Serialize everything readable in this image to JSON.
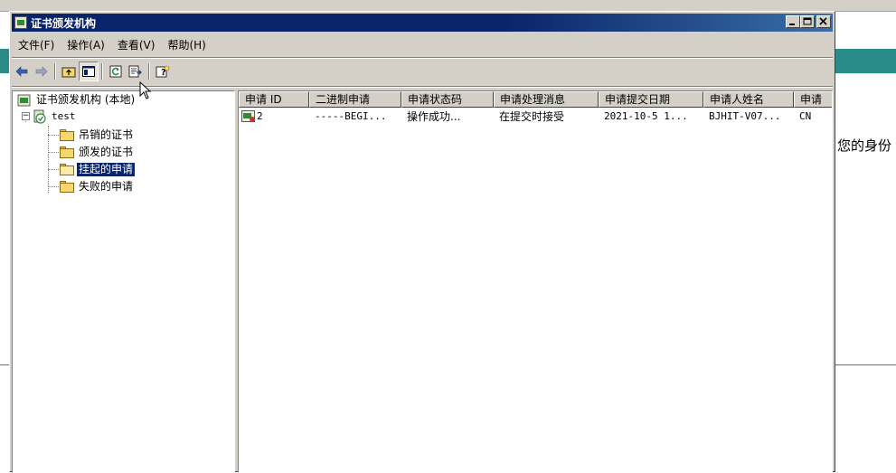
{
  "window": {
    "title": "证书颁发机构",
    "buttons": {
      "minimize": "_",
      "maximize": "□",
      "close": "×"
    }
  },
  "menu": [
    {
      "label": "文件(F)"
    },
    {
      "label": "操作(A)"
    },
    {
      "label": "查看(V)"
    },
    {
      "label": "帮助(H)"
    }
  ],
  "toolbar": {
    "icons": [
      "back-arrow-icon",
      "forward-arrow-icon",
      "up-folder-icon",
      "show-hide-tree-icon",
      "refresh-icon",
      "export-list-icon",
      "help-icon"
    ]
  },
  "tree": {
    "root": "证书颁发机构 (本地)",
    "ca": "test",
    "children": [
      {
        "label": "吊销的证书"
      },
      {
        "label": "颁发的证书"
      },
      {
        "label": "挂起的申请",
        "selected": true
      },
      {
        "label": "失败的申请"
      }
    ]
  },
  "list": {
    "columns": [
      "申请 ID",
      "二进制申请",
      "申请状态码",
      "申请处理消息",
      "申请提交日期",
      "申请人姓名",
      "申请"
    ],
    "rows": [
      [
        "2",
        "-----BEGI...",
        "操作成功...",
        "在提交时接受",
        "2021-10-5 1...",
        "BJHIT-V07...",
        "CN"
      ]
    ]
  },
  "background": {
    "right_text": "您的身份"
  },
  "colors": {
    "titlebar": "#0a246a",
    "selection": "#0a246a",
    "chrome": "#d4d0c8",
    "page_accent": "#2a8c88"
  }
}
